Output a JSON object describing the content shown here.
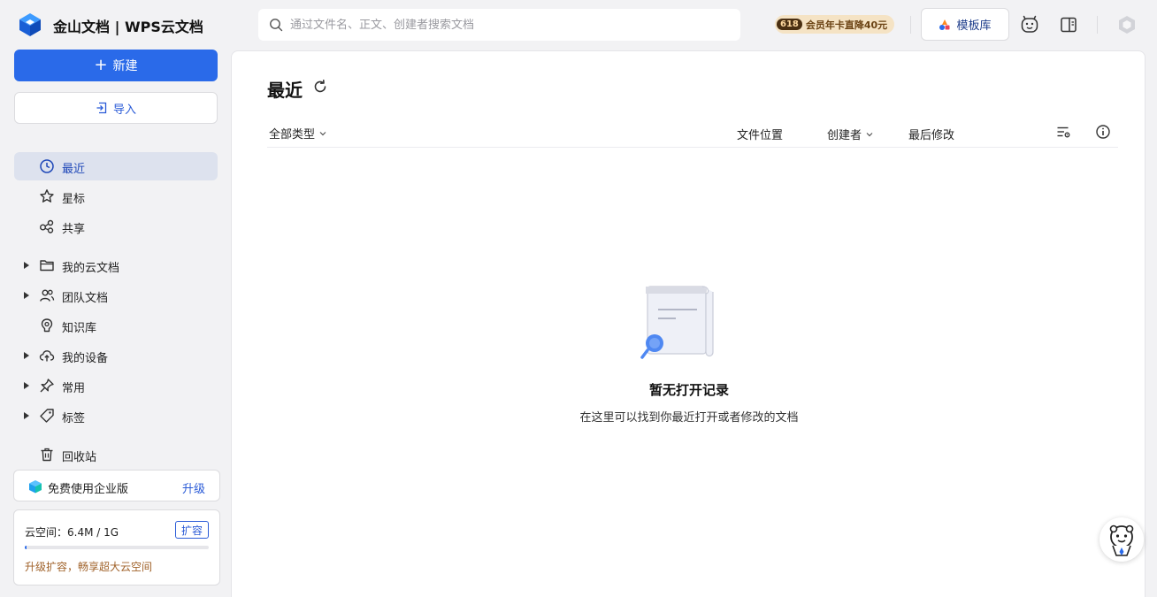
{
  "app": {
    "title": "金山文档 | WPS云文档",
    "brand_color": "#2a6ae9"
  },
  "search": {
    "placeholder": "通过文件名、正文、创建者搜索文档",
    "value": ""
  },
  "promo": {
    "badge": "618",
    "text": "会员年卡直降40元"
  },
  "toolbar": {
    "template_label": "模板库",
    "icons": [
      "sparkle-icon",
      "face-icon",
      "panel-toggle-icon",
      "user-avatar-icon"
    ]
  },
  "sidebar": {
    "new_label": "新建",
    "import_label": "导入",
    "items": [
      {
        "label": "最近",
        "icon": "clock-icon",
        "active": true,
        "expandable": false
      },
      {
        "label": "星标",
        "icon": "star-icon",
        "active": false,
        "expandable": false
      },
      {
        "label": "共享",
        "icon": "share-icon",
        "active": false,
        "expandable": false
      },
      {
        "label": "我的云文档",
        "icon": "folder-icon",
        "active": false,
        "expandable": true
      },
      {
        "label": "团队文档",
        "icon": "team-icon",
        "active": false,
        "expandable": true
      },
      {
        "label": "知识库",
        "icon": "knowledge-icon",
        "active": false,
        "expandable": false
      },
      {
        "label": "我的设备",
        "icon": "cloud-upload-icon",
        "active": false,
        "expandable": true
      },
      {
        "label": "常用",
        "icon": "pin-icon",
        "active": false,
        "expandable": true
      },
      {
        "label": "标签",
        "icon": "tag-icon",
        "active": false,
        "expandable": true
      },
      {
        "label": "回收站",
        "icon": "trash-icon",
        "active": false,
        "expandable": false
      }
    ],
    "enterprise": {
      "label": "免费使用企业版",
      "upgrade_label": "升级"
    },
    "storage": {
      "text": "云空间：6.4M / 1G",
      "expand_label": "扩容",
      "used_fraction": 0.0063,
      "tip": "升级扩容，畅享超大云空间"
    }
  },
  "main": {
    "title": "最近",
    "filter_label": "全部类型",
    "columns": {
      "location": "文件位置",
      "creator": "创建者",
      "modified": "最后修改"
    },
    "empty": {
      "title": "暂无打开记录",
      "subtitle": "在这里可以找到你最近打开或者修改的文档"
    }
  }
}
